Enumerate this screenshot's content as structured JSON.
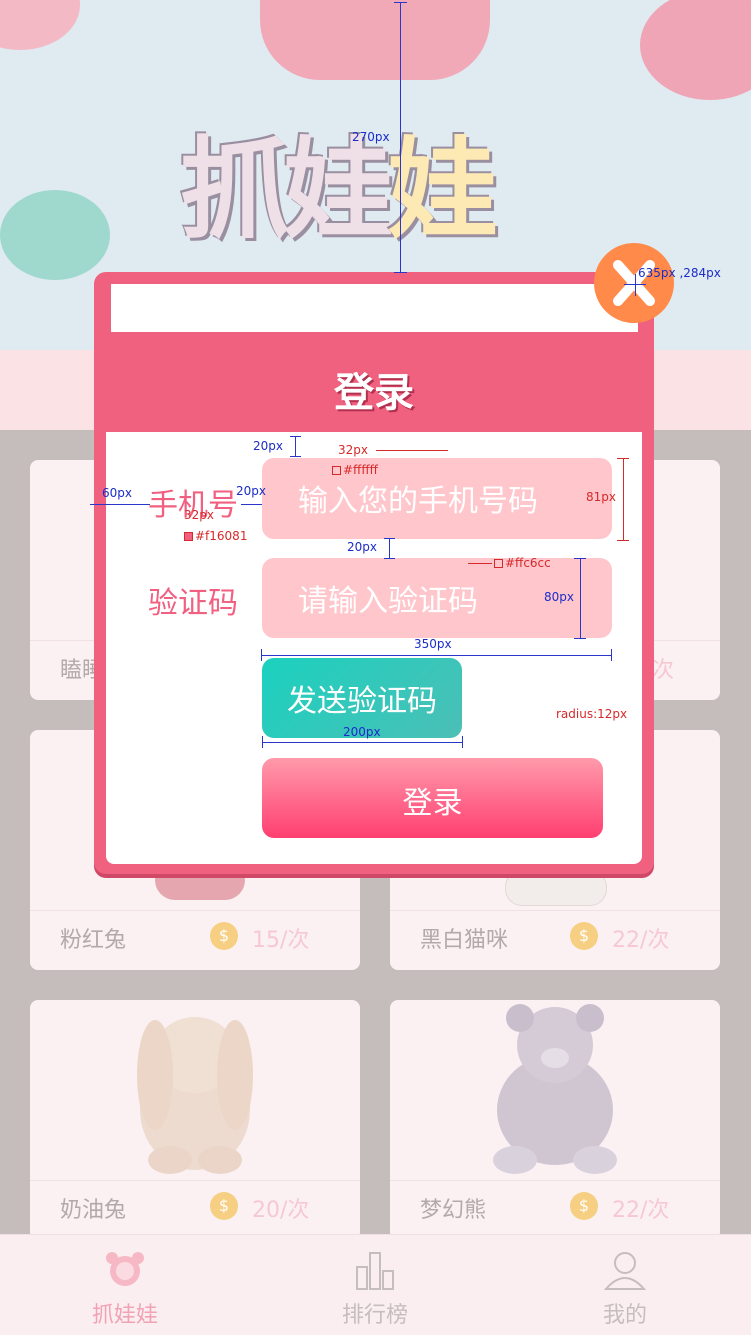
{
  "banner": {
    "title_main": "抓娃",
    "title_last": "娃"
  },
  "products": [
    {
      "name": "瞌睡",
      "price": ""
    },
    {
      "name": "",
      "price": "次"
    },
    {
      "name": "粉红兔",
      "price": "15/次"
    },
    {
      "name": "黑白猫咪",
      "price": "22/次"
    },
    {
      "name": "奶油兔",
      "price": "20/次"
    },
    {
      "name": "梦幻熊",
      "price": "22/次"
    }
  ],
  "tabs": [
    {
      "label": "抓娃娃"
    },
    {
      "label": "排行榜"
    },
    {
      "label": "我的"
    }
  ],
  "modal": {
    "title": "登录",
    "phone_label": "手机号",
    "phone_placeholder": "输入您的手机号码",
    "code_label": "验证码",
    "code_placeholder": "请输入验证码",
    "send_button": "发送验证码",
    "login_button": "登录"
  },
  "annotations": {
    "top_gap": "270px",
    "close_pos": "635px ,284px",
    "gap_20a": "20px",
    "font_32a": "32px",
    "color_white": "#ffffff",
    "label_60": "60px",
    "label_20": "20px",
    "height_81": "81px",
    "font_32b": "32px",
    "color_label": "#f16081",
    "gap_20b": "20px",
    "color_input": "#ffc6cc",
    "height_80": "80px",
    "width_350": "350px",
    "radius": "radius:12px",
    "width_200": "200px"
  },
  "colors": {
    "primary": "#f16081",
    "input_bg": "#ffc6cc",
    "close": "#ff8a4a",
    "send": "#1bd1bf"
  }
}
